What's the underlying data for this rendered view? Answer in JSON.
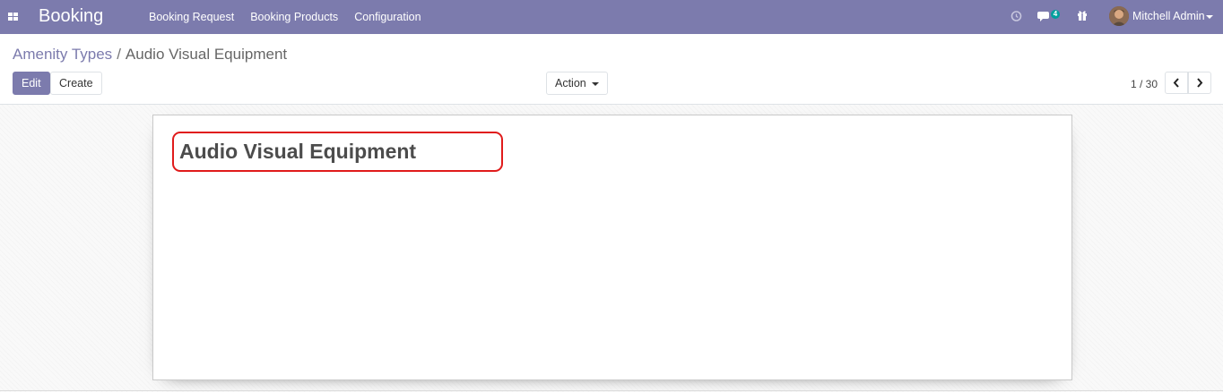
{
  "navbar": {
    "app_name": "Booking",
    "menu": [
      {
        "label": "Booking Request"
      },
      {
        "label": "Booking Products"
      },
      {
        "label": "Configuration"
      }
    ],
    "messages_count": "4",
    "user_name": "Mitchell Admin",
    "icons": {
      "apps": "apps-grid-icon",
      "activity": "clock-icon",
      "messages": "chat-icon",
      "gift": "gift-icon"
    },
    "color": "#7c7bad"
  },
  "control_panel": {
    "breadcrumb": [
      {
        "label": "Amenity Types"
      },
      {
        "label": "Audio Visual Equipment"
      }
    ],
    "breadcrumb_separator": "/",
    "edit_label": "Edit",
    "create_label": "Create",
    "action_label": "Action",
    "pager": "1 / 30"
  },
  "form": {
    "name": "Audio Visual Equipment"
  },
  "colors": {
    "accent": "#7c7bad",
    "highlight": "#e01b1b",
    "badge": "#00a09d"
  }
}
